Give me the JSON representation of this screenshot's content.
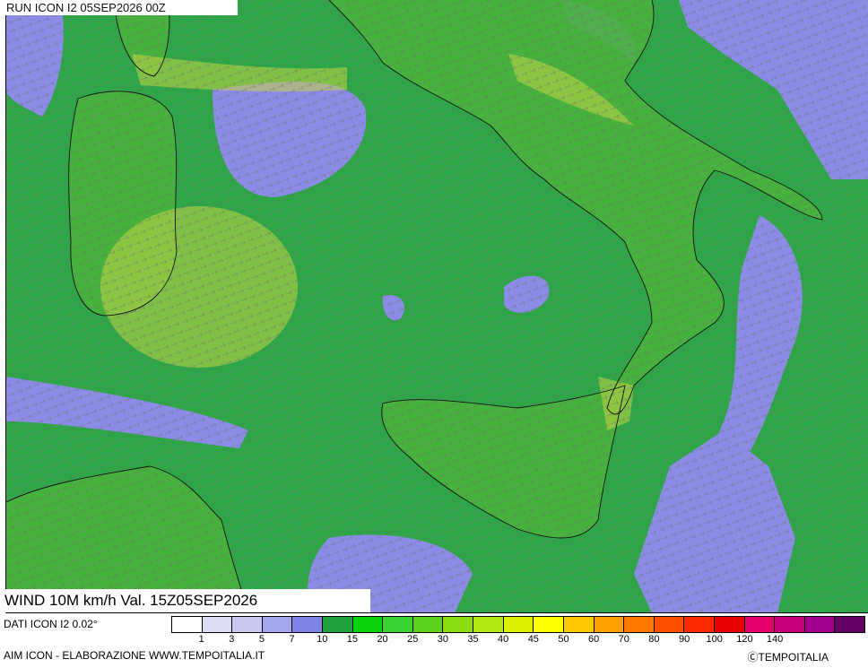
{
  "header": {
    "run_label": "RUN ICON I2 05SEP2026 00Z"
  },
  "map": {
    "title": "WIND 10M km/h Val. 15Z05SEP2026",
    "background_color": "#2ea648",
    "land_color": "#49b43c",
    "light_wind_color": "#8c8ce6",
    "calm_color": "#e6e6f5",
    "strong_wind_color": "#c6d646",
    "arrow_color": "#7a7a7a"
  },
  "legend": {
    "source_label": "DATI ICON I2 0.02°",
    "colors": [
      "#ffffff",
      "#dcdcf5",
      "#c8c8f0",
      "#a5a5f0",
      "#8282e6",
      "#1ea03c",
      "#0ad20a",
      "#3cd232",
      "#5ad21e",
      "#8cdc14",
      "#b4e614",
      "#dcf000",
      "#ffff00",
      "#ffc800",
      "#ffa000",
      "#ff7800",
      "#ff5000",
      "#ff2800",
      "#e60000",
      "#e6006e",
      "#c80078",
      "#a0008c",
      "#640064"
    ],
    "ticks": [
      "1",
      "3",
      "5",
      "7",
      "10",
      "15",
      "20",
      "25",
      "30",
      "35",
      "40",
      "45",
      "50",
      "60",
      "70",
      "80",
      "90",
      "100",
      "120",
      "140"
    ]
  },
  "footer": {
    "left": "AIM ICON - ELABORAZIONE WWW.TEMPOITALIA.IT",
    "right": "ⒸTEMPOITALIA"
  }
}
